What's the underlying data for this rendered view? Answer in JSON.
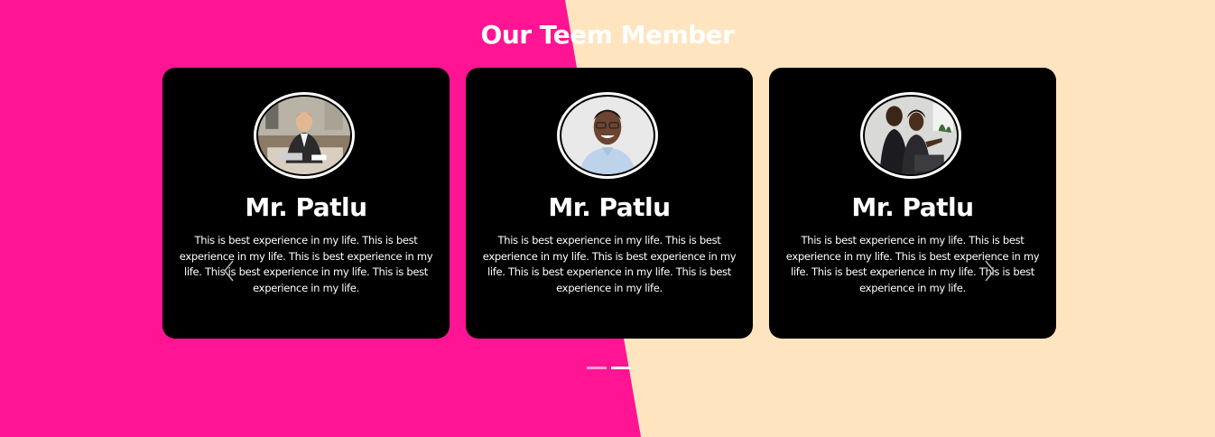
{
  "section": {
    "title": "Our Teem Member"
  },
  "colors": {
    "left_background": "#ff1493",
    "right_background": "#ffe4c0",
    "card_background": "#000000",
    "text": "#ffffff"
  },
  "members": [
    {
      "name": "Mr. Patlu",
      "bio": "This is best experience in my life. This is best experience in my life. This is best experience in my life. This is best experience in my life. This is best experience in my life.",
      "photo": "man-at-desk-with-laptop-photo"
    },
    {
      "name": "Mr. Patlu",
      "bio": "This is best experience in my life. This is best experience in my life. This is best experience in my life. This is best experience in my life. This is best experience in my life.",
      "photo": "smiling-man-with-glasses-photo"
    },
    {
      "name": "Mr. Patlu",
      "bio": "This is best experience in my life. This is best experience in my life. This is best experience in my life. This is best experience in my life. This is best experience in my life.",
      "photo": "two-colleagues-at-laptop-photo"
    }
  ],
  "carousel": {
    "prev_icon": "chevron-left-icon",
    "next_icon": "chevron-right-icon",
    "slide_count": 2,
    "active_slide": 2
  }
}
